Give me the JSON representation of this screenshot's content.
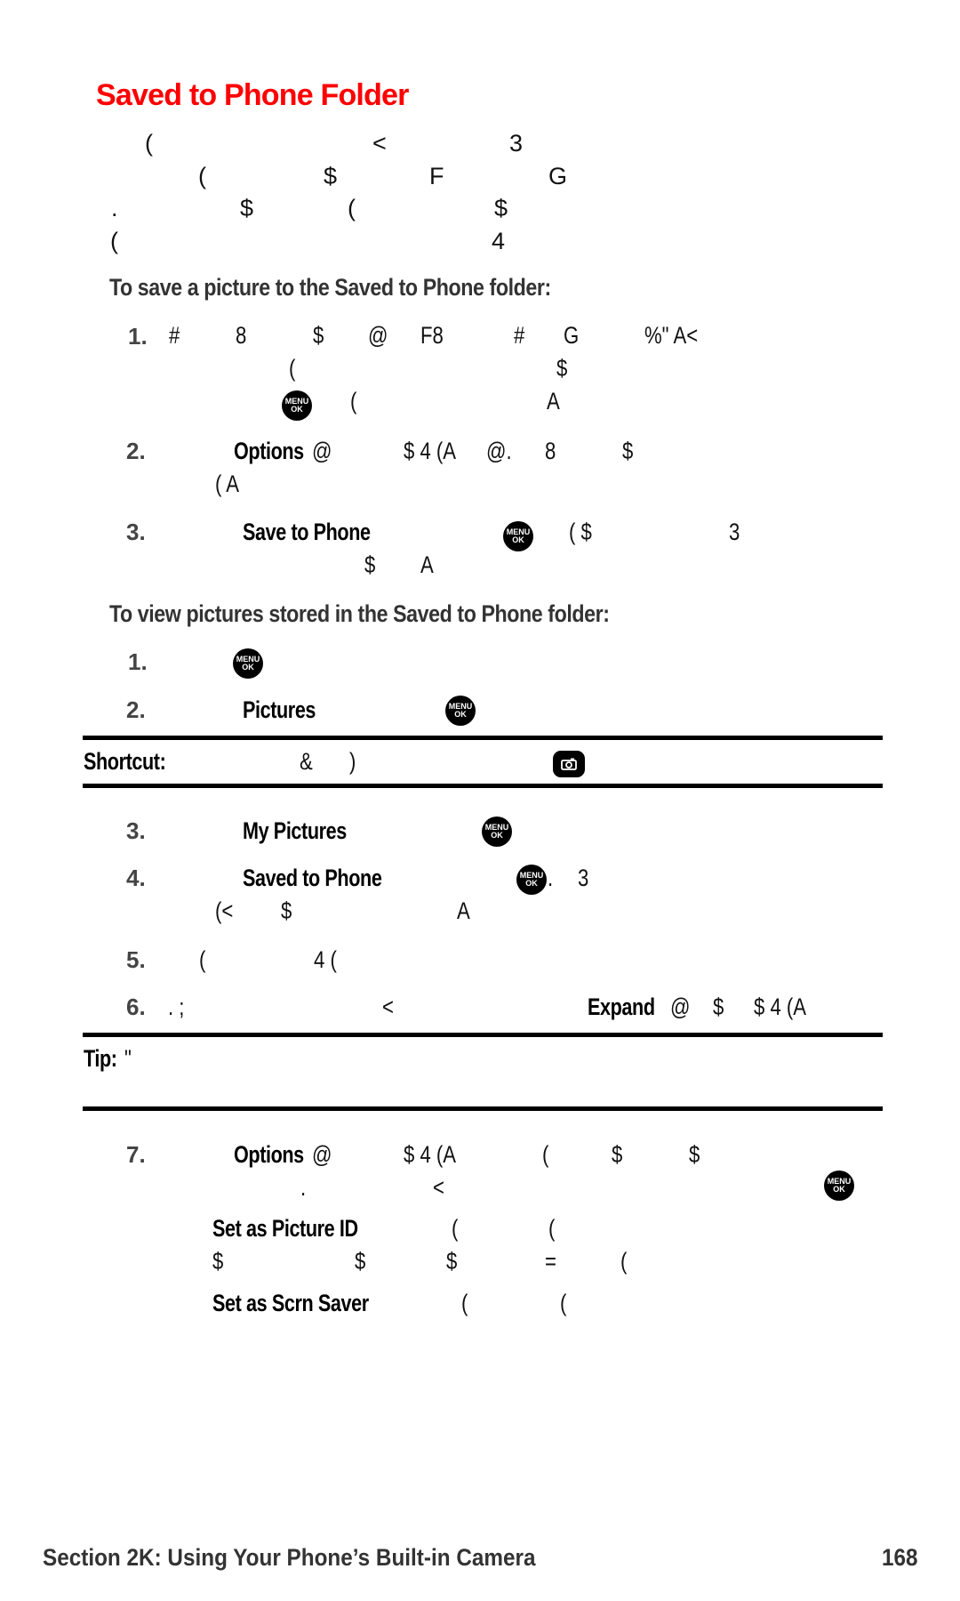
{
  "page": {
    "title": "Saved to Phone Folder",
    "intro_lines": [
      [
        "(",
        "<",
        "3"
      ],
      [
        "(",
        "$",
        "F",
        "G"
      ],
      [
        ".",
        "$",
        "(",
        "$"
      ],
      [
        "(",
        "4"
      ]
    ],
    "section_save": {
      "heading": "To save a picture to the Saved to Phone folder:",
      "steps": [
        {
          "num": "1.",
          "line1": [
            "#",
            "8",
            "$",
            "@",
            "F8",
            "#",
            "G",
            "%\" A<"
          ],
          "line2": [
            "(",
            "$"
          ],
          "line3": [
            "(",
            "A"
          ]
        },
        {
          "num": "2.",
          "bold": "Options",
          "line1": [
            "@",
            "$ 4 (A",
            "@.",
            "8",
            "$"
          ],
          "line2": [
            "( A"
          ]
        },
        {
          "num": "3.",
          "bold": "Save to Phone",
          "line1": [
            "( $",
            "3"
          ],
          "line2": [
            "$",
            "A"
          ]
        }
      ]
    },
    "section_view": {
      "heading": "To view pictures stored in the Saved to Phone folder:",
      "steps": [
        {
          "num": "1."
        },
        {
          "num": "2.",
          "bold": "Pictures"
        }
      ],
      "shortcut": {
        "label": "Shortcut:",
        "glyphs": [
          "&",
          ")"
        ]
      },
      "steps_cont": [
        {
          "num": "3.",
          "bold": "My Pictures"
        },
        {
          "num": "4.",
          "bold": "Saved to Phone",
          "after_icon": ".",
          "glyph": "3",
          "line2": [
            "(<",
            "$",
            "A"
          ]
        },
        {
          "num": "5.",
          "line1": [
            "(",
            "4 ("
          ]
        },
        {
          "num": "6.",
          "line1": [
            ". ;",
            "<"
          ],
          "bold": "Expand",
          "after_bold": [
            "@",
            "$",
            "$ 4 (A"
          ]
        }
      ],
      "tip": {
        "label": "Tip:",
        "glyph": "\""
      },
      "step7": {
        "num": "7.",
        "bold": "Options",
        "line1": [
          "@",
          "$ 4 (A",
          "(",
          "$",
          "$"
        ],
        "line2": [
          ".",
          "<"
        ],
        "option_picture_id": {
          "label": "Set as Picture ID",
          "glyphs": [
            "(",
            "("
          ],
          "line2": [
            "$",
            "$",
            "$",
            "=",
            "("
          ]
        },
        "option_scrn_saver": {
          "label": "Set as Scrn Saver",
          "glyphs": [
            "(",
            "("
          ]
        }
      }
    },
    "icons": {
      "menu_ok_top": "MENU",
      "menu_ok_bottom": "OK"
    },
    "footer": {
      "section": "Section 2K: Using Your Phone’s Built-in Camera",
      "page_number": "168"
    }
  }
}
